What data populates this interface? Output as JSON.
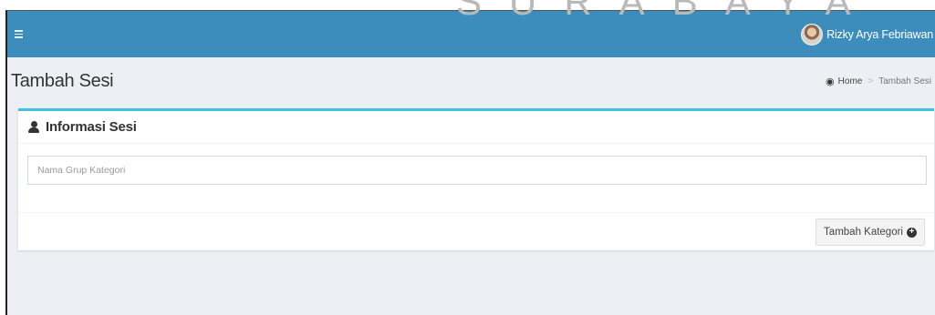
{
  "watermark": {
    "text": "SURABAYA"
  },
  "topbar": {
    "menu_icon": "hamburger-icon",
    "user_name": "Rizky Arya Febriawan",
    "accent_color": "#3c8dbc"
  },
  "header": {
    "title": "Tambah Sesi",
    "breadcrumb": {
      "home_icon": "dashboard-icon",
      "home": "Home",
      "separator": ">",
      "current": "Tambah Sesi"
    }
  },
  "box": {
    "icon": "user-icon",
    "title": "Informasi Sesi",
    "border_color": "#3ec2e6",
    "input": {
      "placeholder": "Nama Grup Kategori",
      "value": ""
    },
    "button": {
      "label": "Tambah Kategori",
      "icon": "plus-circle-icon"
    }
  }
}
